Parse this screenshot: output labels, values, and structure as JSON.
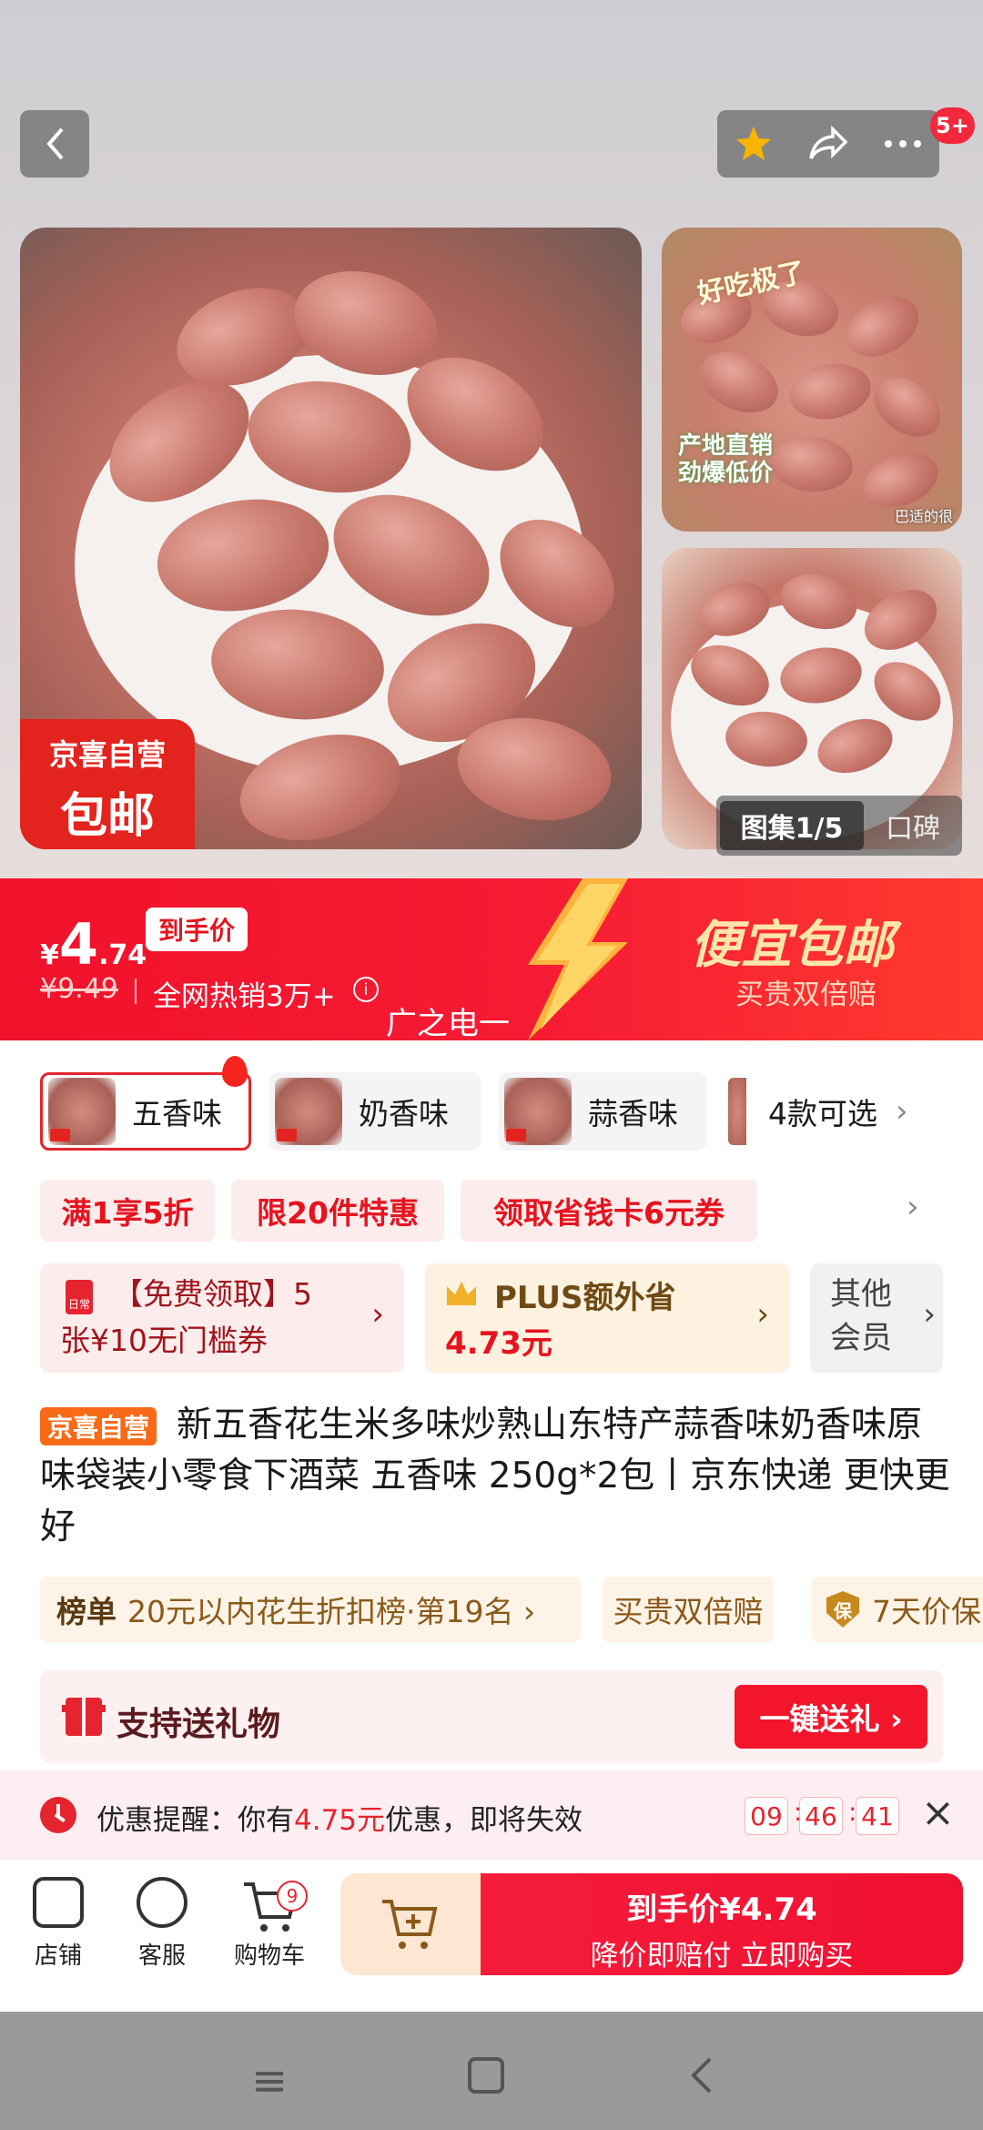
{
  "header": {
    "back_icon": "chevron-left-icon",
    "actions": [
      "star-icon",
      "share-icon",
      "more-icon"
    ],
    "message_badge": "5+"
  },
  "gallery": {
    "main_badge_line1": "京喜自营",
    "main_badge_line2": "包邮",
    "sub1_text1": "好吃极了",
    "sub1_text2": "产地直销 劲爆低价",
    "sub1_text3": "巴适的很",
    "tab_images": "图集1/5",
    "tab_reviews": "口碑"
  },
  "price": {
    "currency": "¥",
    "integer": "4",
    "decimal": ".74",
    "tag": "到手价",
    "original": "¥9.49",
    "hot_sales": "全网热销3万+",
    "bolt_label": "广之电一",
    "promo_title": "便宜包邮",
    "promo_sub": "买贵双倍赔"
  },
  "variants": {
    "items": [
      {
        "label": "五香味",
        "selected": true
      },
      {
        "label": "奶香味",
        "selected": false
      },
      {
        "label": "蒜香味",
        "selected": false
      }
    ],
    "more": "4款可选"
  },
  "coupons": [
    "满1享5折",
    "限20件特惠",
    "领取省钱卡6元券"
  ],
  "benefits": {
    "free_coupon_line1": "【免费领取】5",
    "free_coupon_line2": "张¥10无门槛券",
    "calendar_label": "日常",
    "plus_line1": "PLUS额外省",
    "plus_line2": "4.73元",
    "other_members": "其他会员"
  },
  "product": {
    "shop_tag": "京喜自营",
    "title": "新五香花生米多味炒熟山东特产蒜香味奶香味原味袋装小零食下酒菜 五香味 250g*2包丨京东快递 更快更好"
  },
  "tags": {
    "rank_label": "榜单",
    "rank_text": "20元以内花生折扣榜·第19名 ›",
    "double_pay": "买贵双倍赔",
    "guarantee_icon": "保",
    "guarantee_text": "7天价保"
  },
  "gift": {
    "label": "支持送礼物",
    "button": "一键送礼 ›"
  },
  "reminder": {
    "prefix": "优惠提醒：你有",
    "amount": "4.75元",
    "suffix": "优惠，即将失效",
    "hh": "09",
    "mm": "46",
    "ss": "41"
  },
  "bottom_bar": {
    "shop": "店铺",
    "service": "客服",
    "cart": "购物车",
    "cart_count": "9",
    "buy_line1": "到手价¥4.74",
    "buy_line2": "降价即赔付 立即购买"
  },
  "colors": {
    "accent": "#f2152b",
    "price_banner": "#f0122a",
    "promo_gold": "#ffe6a8"
  }
}
